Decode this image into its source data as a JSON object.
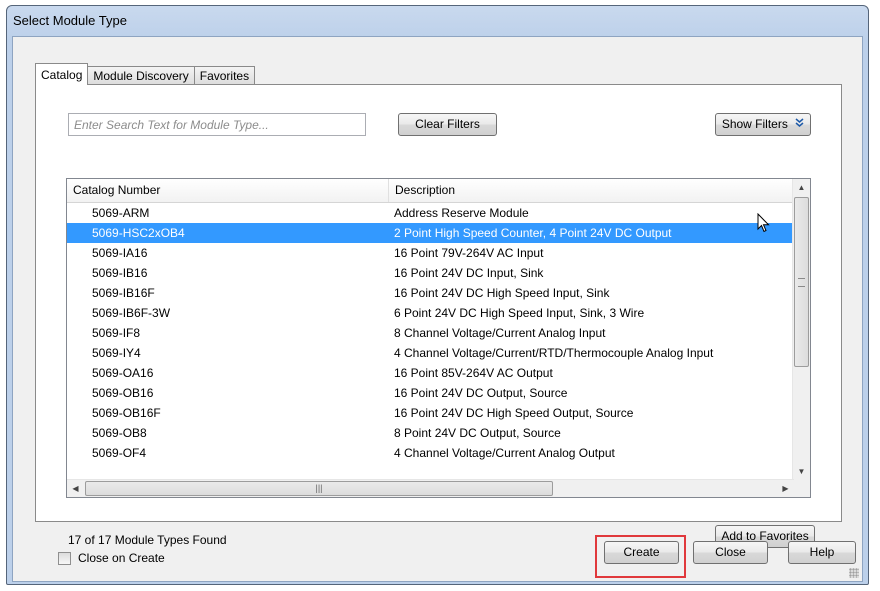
{
  "window": {
    "title": "Select Module Type"
  },
  "tabs": [
    {
      "label": "Catalog",
      "active": true
    },
    {
      "label": "Module Discovery",
      "active": false
    },
    {
      "label": "Favorites",
      "active": false
    }
  ],
  "search": {
    "placeholder": "Enter Search Text for Module Type...",
    "value": ""
  },
  "buttons": {
    "clear_filters": "Clear Filters",
    "show_filters": "Show Filters",
    "show_filters_icon": "double-chevron-down-icon",
    "add_to_favorites": "Add to Favorites",
    "create": "Create",
    "close": "Close",
    "help": "Help"
  },
  "table": {
    "columns": [
      "Catalog Number",
      "Description"
    ],
    "rows": [
      {
        "catalog": "5069-ARM",
        "description": "Address Reserve Module"
      },
      {
        "catalog": "5069-HSC2xOB4",
        "description": "2 Point High Speed Counter, 4 Point 24V DC Output",
        "selected": true
      },
      {
        "catalog": "5069-IA16",
        "description": "16 Point 79V-264V AC Input"
      },
      {
        "catalog": "5069-IB16",
        "description": "16 Point 24V DC Input, Sink"
      },
      {
        "catalog": "5069-IB16F",
        "description": "16 Point 24V DC High Speed Input, Sink"
      },
      {
        "catalog": "5069-IB6F-3W",
        "description": "6 Point 24V DC High Speed Input, Sink, 3 Wire"
      },
      {
        "catalog": "5069-IF8",
        "description": "8 Channel Voltage/Current Analog Input"
      },
      {
        "catalog": "5069-IY4",
        "description": "4 Channel Voltage/Current/RTD/Thermocouple Analog Input"
      },
      {
        "catalog": "5069-OA16",
        "description": "16 Point 85V-264V AC Output"
      },
      {
        "catalog": "5069-OB16",
        "description": "16 Point 24V DC Output, Source"
      },
      {
        "catalog": "5069-OB16F",
        "description": "16 Point 24V DC High Speed Output, Source"
      },
      {
        "catalog": "5069-OB8",
        "description": "8 Point 24V DC Output, Source"
      },
      {
        "catalog": "5069-OF4",
        "description": "4 Channel Voltage/Current Analog Output"
      }
    ]
  },
  "status": {
    "found_text": "17 of 17 Module Types Found"
  },
  "close_on_create": {
    "label": "Close on Create",
    "checked": false
  },
  "colors": {
    "selection": "#3399ff",
    "highlight_box": "#e0383c",
    "title_bar": "#bcd0ea"
  }
}
